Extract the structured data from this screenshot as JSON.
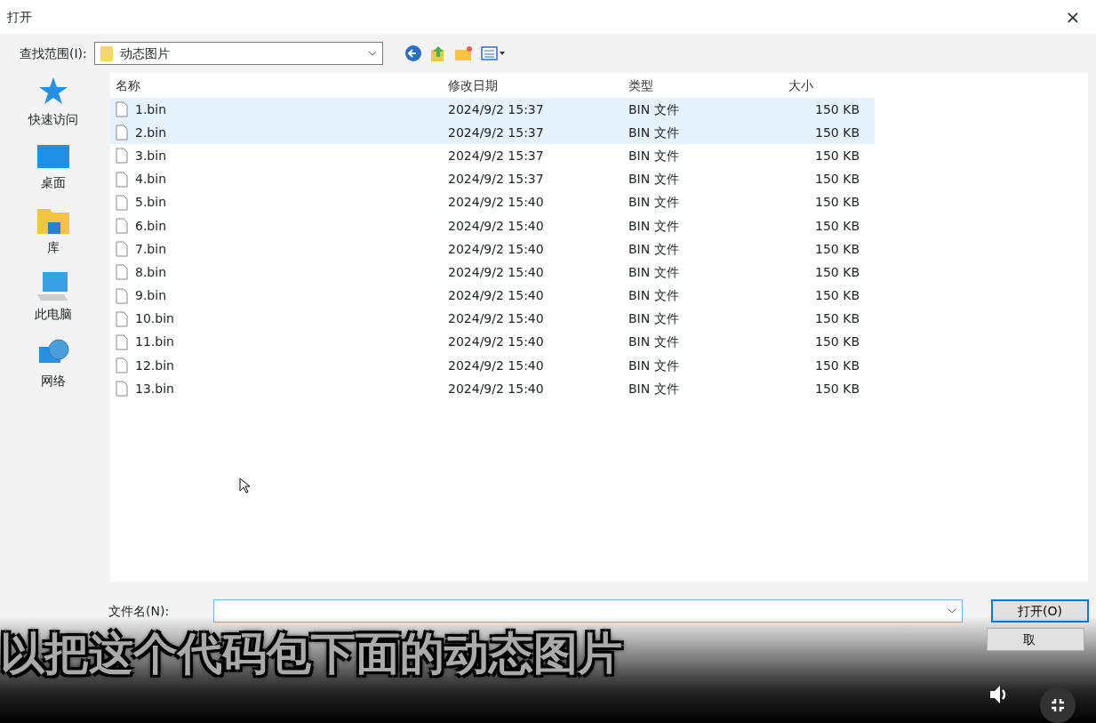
{
  "window": {
    "title": "打开",
    "close": "×"
  },
  "location": {
    "label": "查找范围(I):",
    "value": "动态图片"
  },
  "places": [
    {
      "label": "快速访问",
      "kind": "star"
    },
    {
      "label": "桌面",
      "kind": "desktop"
    },
    {
      "label": "库",
      "kind": "library"
    },
    {
      "label": "此电脑",
      "kind": "computer"
    },
    {
      "label": "网络",
      "kind": "network"
    }
  ],
  "columns": [
    "名称",
    "修改日期",
    "类型",
    "大小"
  ],
  "files": [
    {
      "name": "1.bin",
      "modified": "2024/9/2 15:37",
      "type": "BIN 文件",
      "size": "150 KB",
      "selected": true
    },
    {
      "name": "2.bin",
      "modified": "2024/9/2 15:37",
      "type": "BIN 文件",
      "size": "150 KB",
      "selected": true
    },
    {
      "name": "3.bin",
      "modified": "2024/9/2 15:37",
      "type": "BIN 文件",
      "size": "150 KB",
      "selected": false
    },
    {
      "name": "4.bin",
      "modified": "2024/9/2 15:37",
      "type": "BIN 文件",
      "size": "150 KB",
      "selected": false
    },
    {
      "name": "5.bin",
      "modified": "2024/9/2 15:40",
      "type": "BIN 文件",
      "size": "150 KB",
      "selected": false
    },
    {
      "name": "6.bin",
      "modified": "2024/9/2 15:40",
      "type": "BIN 文件",
      "size": "150 KB",
      "selected": false
    },
    {
      "name": "7.bin",
      "modified": "2024/9/2 15:40",
      "type": "BIN 文件",
      "size": "150 KB",
      "selected": false
    },
    {
      "name": "8.bin",
      "modified": "2024/9/2 15:40",
      "type": "BIN 文件",
      "size": "150 KB",
      "selected": false
    },
    {
      "name": "9.bin",
      "modified": "2024/9/2 15:40",
      "type": "BIN 文件",
      "size": "150 KB",
      "selected": false
    },
    {
      "name": "10.bin",
      "modified": "2024/9/2 15:40",
      "type": "BIN 文件",
      "size": "150 KB",
      "selected": false
    },
    {
      "name": "11.bin",
      "modified": "2024/9/2 15:40",
      "type": "BIN 文件",
      "size": "150 KB",
      "selected": false
    },
    {
      "name": "12.bin",
      "modified": "2024/9/2 15:40",
      "type": "BIN 文件",
      "size": "150 KB",
      "selected": false
    },
    {
      "name": "13.bin",
      "modified": "2024/9/2 15:40",
      "type": "BIN 文件",
      "size": "150 KB",
      "selected": false
    }
  ],
  "filename": {
    "label": "文件名(N):"
  },
  "buttons": [
    "打开(O)",
    "取"
  ],
  "subtitle": "以把这个代码包下面的动态图片"
}
